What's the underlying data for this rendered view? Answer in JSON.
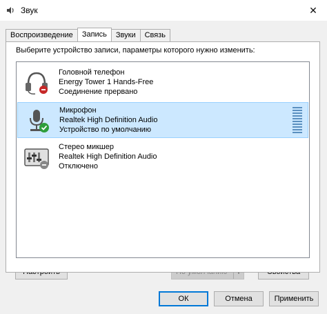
{
  "window": {
    "title": "Звук",
    "icon": "speaker-icon",
    "close_glyph": "✕"
  },
  "tabs": [
    {
      "label": "Воспроизведение",
      "active": false
    },
    {
      "label": "Запись",
      "active": true
    },
    {
      "label": "Звуки",
      "active": false
    },
    {
      "label": "Связь",
      "active": false
    }
  ],
  "instruction": "Выберите устройство записи, параметры которого нужно изменить:",
  "devices": [
    {
      "name": "Головной телефон",
      "driver": "Energy Tower 1 Hands-Free",
      "status": "Соединение прервано",
      "icon": "headset-icon",
      "selected": false
    },
    {
      "name": "Микрофон",
      "driver": "Realtek High Definition Audio",
      "status": "Устройство по умолчанию",
      "icon": "microphone-icon",
      "selected": true
    },
    {
      "name": "Стерео микшер",
      "driver": "Realtek High Definition Audio",
      "status": "Отключено",
      "icon": "stereo-mixer-icon",
      "selected": false
    }
  ],
  "buttons": {
    "configure": "Настроить",
    "set_default": "По умолчанию",
    "properties": "Свойства",
    "ok": "ОК",
    "cancel": "Отмена",
    "apply": "Применить"
  },
  "colors": {
    "selection_bg": "#cce8ff",
    "selection_border": "#99d1ff",
    "primary_border": "#0078d7",
    "default_check": "#2e9e3b"
  }
}
